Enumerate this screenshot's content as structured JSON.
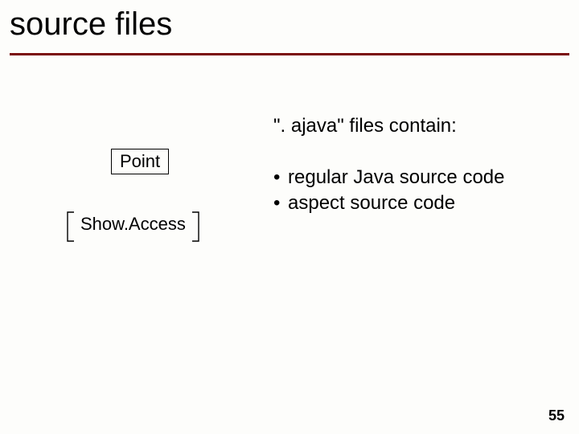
{
  "title": "source files",
  "box_point": "Point",
  "box_showaccess": "Show.Access",
  "description": "\". ajava\" files contain:",
  "bullet1": "regular Java source code",
  "bullet2": "aspect source code",
  "page_number": "55"
}
